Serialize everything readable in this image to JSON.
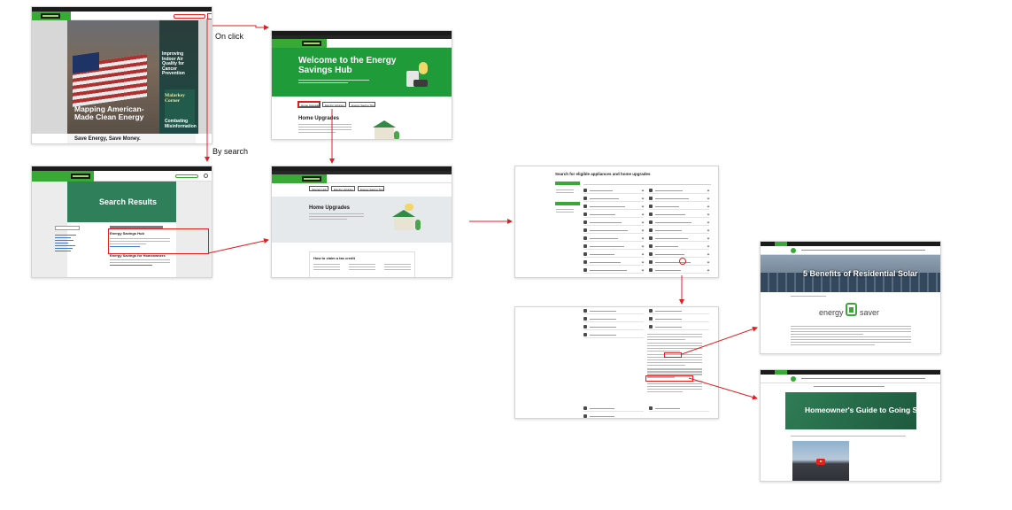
{
  "annotations": {
    "on_click": "On click",
    "by_search": "By search"
  },
  "screens": {
    "home": {
      "hero_left_title": "Mapping American-Made Clean Energy",
      "hero_right_top": "Improving Indoor Air Quality for Cancer Prevention",
      "hero_right_bottom": "Combating Misinformation",
      "malarkey": "Malarkey Corner",
      "footer_text": "Save Energy, Save Money."
    },
    "hub": {
      "title": "Welcome to the Energy Savings Hub",
      "tabs": [
        "Home Upgrades",
        "Electric Vehicles",
        "Energy Saving Tips"
      ],
      "section_title": "Home Upgrades"
    },
    "search_results": {
      "title": "Search Results",
      "result_title": "Energy Savings Hub",
      "result2_title": "Energy Savings for Homeowners"
    },
    "hub_scrolled": {
      "tabs": [
        "Savings Hub",
        "Electric Vehicles",
        "Energy Saving Tips"
      ],
      "section_title": "Home Upgrades",
      "claim_title": "How to claim a tax credit"
    },
    "appliances": {
      "title": "Search for eligible appliances and home upgrades"
    },
    "solar_article": {
      "title": "5 Benefits of Residential Solar",
      "logo_text_left": "energy",
      "logo_text_right": "saver"
    },
    "solar_guide": {
      "title": "Homeowner's Guide to Going Solar"
    }
  },
  "colors": {
    "brand_green": "#39a935",
    "hub_green": "#1f9b3a",
    "arrow_red": "#e02020",
    "dark_bar": "#1b1b1b"
  }
}
